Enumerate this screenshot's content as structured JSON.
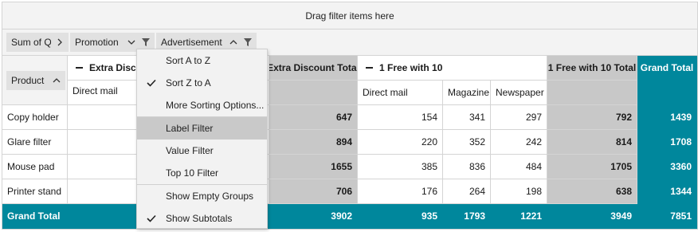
{
  "filter_area": {
    "label": "Drag filter items here"
  },
  "values_pill": {
    "label": "Sum of Q",
    "icon": "chevron-right"
  },
  "promotion_pill": {
    "label": "Promotion",
    "chevron": "chevron-down",
    "filter": "filter-funnel"
  },
  "advertisement_pill": {
    "label": "Advertisement",
    "chevron": "chevron-up",
    "filter": "filter-funnel"
  },
  "product_pill": {
    "label": "Product",
    "icon": "chevron-up"
  },
  "column_groups": {
    "extra_discount": "Extra Disco",
    "extra_discount_total": "Extra Discount Total",
    "free_with_10": "1 Free with 10",
    "free_with_10_total": "1 Free with 10 Total",
    "grand_total": "Grand Total"
  },
  "sub_headers": {
    "ed_direct_mail": "Direct mail",
    "fw_direct_mail": "Direct mail",
    "fw_magazine": "Magazine",
    "fw_newspaper": "Newspaper"
  },
  "rows": [
    {
      "name": "Copy holder",
      "ed_total": "647",
      "fw_direct_mail": "154",
      "fw_magazine": "341",
      "fw_newspaper": "297",
      "fw_total": "792",
      "grand": "1439"
    },
    {
      "name": "Glare filter",
      "ed_total": "894",
      "fw_direct_mail": "220",
      "fw_magazine": "352",
      "fw_newspaper": "242",
      "fw_total": "814",
      "grand": "1708"
    },
    {
      "name": "Mouse pad",
      "ed_total": "1655",
      "fw_direct_mail": "385",
      "fw_magazine": "836",
      "fw_newspaper": "484",
      "fw_total": "1705",
      "grand": "3360"
    },
    {
      "name": "Printer stand",
      "ed_total": "706",
      "fw_direct_mail": "176",
      "fw_magazine": "264",
      "fw_newspaper": "198",
      "fw_total": "638",
      "grand": "1344"
    }
  ],
  "grand_total_row": {
    "label": "Grand Total",
    "ed_total": "3902",
    "fw_direct_mail": "935",
    "fw_magazine": "1793",
    "fw_newspaper": "1221",
    "fw_total": "3949",
    "grand": "7851"
  },
  "context_menu": {
    "items": [
      {
        "label": "Sort A to Z",
        "checked": false
      },
      {
        "label": "Sort Z to A",
        "checked": true
      },
      {
        "label": "More Sorting Options...",
        "checked": false
      },
      {
        "label": "Label Filter",
        "checked": false,
        "highlighted": true
      },
      {
        "label": "Value Filter",
        "checked": false
      },
      {
        "label": "Top 10 Filter",
        "checked": false
      },
      {
        "label": "Show Empty Groups",
        "checked": false
      },
      {
        "label": "Show Subtotals",
        "checked": true
      }
    ]
  },
  "colors": {
    "accent": "#00879c",
    "subtotal": "#c8c8c8",
    "panel": "#f3f3f3",
    "menu_highlight": "#c9c9c9"
  }
}
